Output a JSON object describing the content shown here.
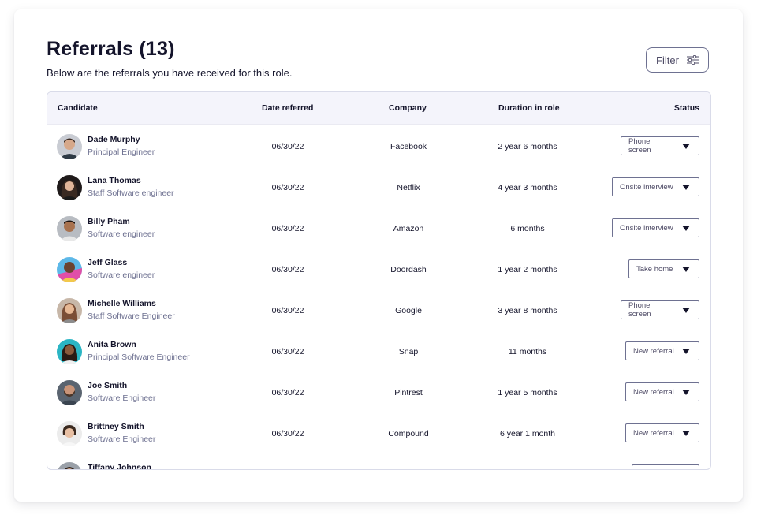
{
  "header": {
    "title": "Referrals (13)",
    "subtitle": "Below are the referrals you have received for this role.",
    "filter_label": "Filter"
  },
  "table": {
    "columns": [
      "Candidate",
      "Date referred",
      "Company",
      "Duration in role",
      "Status"
    ],
    "rows": [
      {
        "name": "Dade Murphy",
        "title": "Principal Engineer",
        "date": "06/30/22",
        "company": "Facebook",
        "duration": "2 year 6 months",
        "status": "Phone screen"
      },
      {
        "name": "Lana Thomas",
        "title": "Staff Software engineer",
        "date": "06/30/22",
        "company": "Netflix",
        "duration": "4 year 3 months",
        "status": "Onsite interview"
      },
      {
        "name": "Billy Pham",
        "title": "Software engineer",
        "date": "06/30/22",
        "company": "Amazon",
        "duration": "6 months",
        "status": "Onsite interview"
      },
      {
        "name": "Jeff Glass",
        "title": "Software engineer",
        "date": "06/30/22",
        "company": "Doordash",
        "duration": "1 year 2 months",
        "status": "Take home"
      },
      {
        "name": "Michelle Williams",
        "title": "Staff Software Engineer",
        "date": "06/30/22",
        "company": "Google",
        "duration": "3 year 8 months",
        "status": "Phone screen"
      },
      {
        "name": "Anita Brown",
        "title": "Principal Software Engineer",
        "date": "06/30/22",
        "company": "Snap",
        "duration": "11 months",
        "status": "New referral"
      },
      {
        "name": "Joe Smith",
        "title": "Software Engineer",
        "date": "06/30/22",
        "company": "Pintrest",
        "duration": "1 year 5 months",
        "status": "New referral"
      },
      {
        "name": "Brittney Smith",
        "title": "Software Engineer",
        "date": "06/30/22",
        "company": "Compound",
        "duration": "6 year 1 month",
        "status": "New referral"
      },
      {
        "name": "Tiffany Johnson",
        "title": "",
        "date": "",
        "company": "",
        "duration": "",
        "status": ""
      }
    ]
  },
  "icons": {
    "filter": "sliders-icon",
    "avatar": "avatar-photo",
    "status_caret": "caret-down-icon"
  },
  "colors": {
    "text_dark": "#14142b",
    "text_muted": "#6e7191",
    "header_bg": "#f4f4fb",
    "border": "#d9dbe9"
  }
}
